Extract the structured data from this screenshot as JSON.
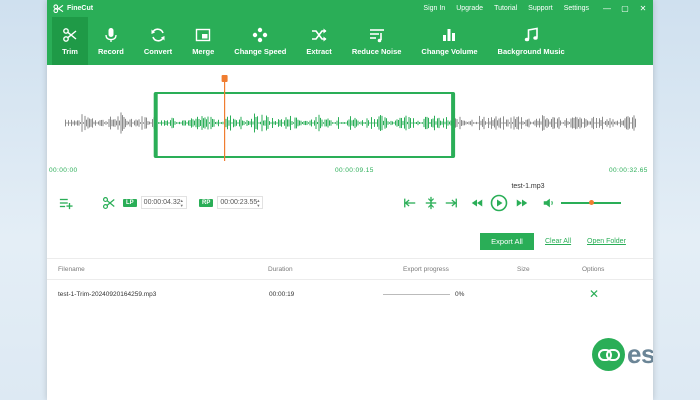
{
  "app": {
    "name": "FineCut",
    "title_links": [
      "Sign In",
      "Upgrade",
      "Tutorial",
      "Support",
      "Settings"
    ],
    "window_controls": [
      "—",
      "▢",
      "✕"
    ]
  },
  "toolbar": {
    "tools": [
      {
        "label": "Trim",
        "icon": "scissors-icon",
        "active": true
      },
      {
        "label": "Record",
        "icon": "microphone-icon",
        "active": false
      },
      {
        "label": "Convert",
        "icon": "convert-icon",
        "active": false
      },
      {
        "label": "Merge",
        "icon": "merge-icon",
        "active": false
      },
      {
        "label": "Change Speed",
        "icon": "speed-icon",
        "active": false
      },
      {
        "label": "Extract",
        "icon": "extract-icon",
        "active": false
      },
      {
        "label": "Reduce Noise",
        "icon": "noise-icon",
        "active": false
      },
      {
        "label": "Change Volume",
        "icon": "volume-bars-icon",
        "active": false
      },
      {
        "label": "Background Music",
        "icon": "music-note-icon",
        "active": false
      }
    ]
  },
  "waveform": {
    "time_start": "00:00:00",
    "time_mid": "00:00:09.15",
    "time_end": "00:00:32.65",
    "selection_start_fraction": 0.16,
    "selection_end_fraction": 0.68,
    "playhead_fraction": 0.28
  },
  "current_file": "test-1.mp3",
  "controls": {
    "lp_label": "LP",
    "lp_value": "00:00:04.32",
    "rp_label": "RP",
    "rp_value": "00:00:23.55",
    "volume_level": 0.5,
    "icons": [
      "add-list-icon",
      "scissors-icon",
      "go-start-icon",
      "split-icon",
      "go-end-icon",
      "rewind-icon",
      "play-icon",
      "fast-forward-icon",
      "speaker-icon"
    ]
  },
  "actions": {
    "export_all": "Export All",
    "clear_all": "Clear All",
    "open_folder": "Open Folder"
  },
  "table": {
    "headers": [
      "Filename",
      "Duration",
      "Export progress",
      "Size",
      "Options"
    ],
    "rows": [
      {
        "filename": "test-1-Trim-20240920164259.mp3",
        "duration": "00:00:19",
        "progress": "0%",
        "progress_value": 0,
        "size": ""
      }
    ]
  },
  "watermark": {
    "text": "eskTop"
  },
  "colors": {
    "accent": "#2aae57",
    "accent_dark": "#1f9a47",
    "playhead": "#f07d30",
    "wave_outside": "#8a8a8a"
  }
}
